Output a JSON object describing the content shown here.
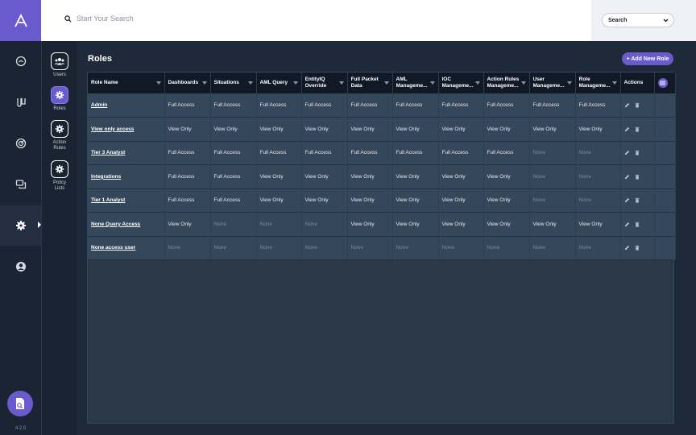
{
  "search": {
    "placeholder": "Start Your Search",
    "select_value": "Search"
  },
  "version": "4.2.0",
  "subnav": [
    {
      "label": "Users"
    },
    {
      "label": "Roles"
    },
    {
      "label": "Action Rules"
    },
    {
      "label": "Policy Lists"
    }
  ],
  "page": {
    "title": "Roles",
    "add_button": "+ Add New Role"
  },
  "table": {
    "columns": [
      "Role Name",
      "Dashboards",
      "Situations",
      "AML Query",
      "EntityIQ Override",
      "Full Packet Data",
      "AML Manageme...",
      "IOC Manageme...",
      "Action Rules Manageme...",
      "User Manageme...",
      "Role Manageme...",
      "Actions"
    ],
    "rows": [
      {
        "name": "Admin",
        "cells": [
          "Full Access",
          "Full Access",
          "Full Access",
          "Full Access",
          "Full Access",
          "Full Access",
          "Full Access",
          "Full Access",
          "Full Access",
          "Full Access"
        ]
      },
      {
        "name": "View only access",
        "cells": [
          "View Only",
          "View Only",
          "View Only",
          "View Only",
          "View Only",
          "View Only",
          "View Only",
          "View Only",
          "View Only",
          "View Only"
        ]
      },
      {
        "name": "Tier 3 Analyst",
        "cells": [
          "Full Access",
          "Full Access",
          "Full Access",
          "Full Access",
          "Full Access",
          "Full Access",
          "Full Access",
          "Full Access",
          "None",
          "None"
        ]
      },
      {
        "name": "Integrations",
        "cells": [
          "Full Access",
          "Full Access",
          "View Only",
          "View Only",
          "View Only",
          "View Only",
          "View Only",
          "View Only",
          "None",
          "None"
        ]
      },
      {
        "name": "Tier 1 Analyst",
        "cells": [
          "Full Access",
          "Full Access",
          "View Only",
          "View Only",
          "View Only",
          "View Only",
          "View Only",
          "View Only",
          "None",
          "None"
        ]
      },
      {
        "name": "None Query Access",
        "cells": [
          "View Only",
          "None",
          "None",
          "None",
          "View Only",
          "View Only",
          "View Only",
          "View Only",
          "View Only",
          "View Only"
        ]
      },
      {
        "name": "None access user",
        "cells": [
          "None",
          "None",
          "None",
          "None",
          "None",
          "None",
          "None",
          "None",
          "None",
          "None"
        ]
      }
    ]
  },
  "colors": {
    "accent": "#6a5acd",
    "background": "#1e2a3a",
    "row": "#35475a",
    "header": "#111927"
  }
}
